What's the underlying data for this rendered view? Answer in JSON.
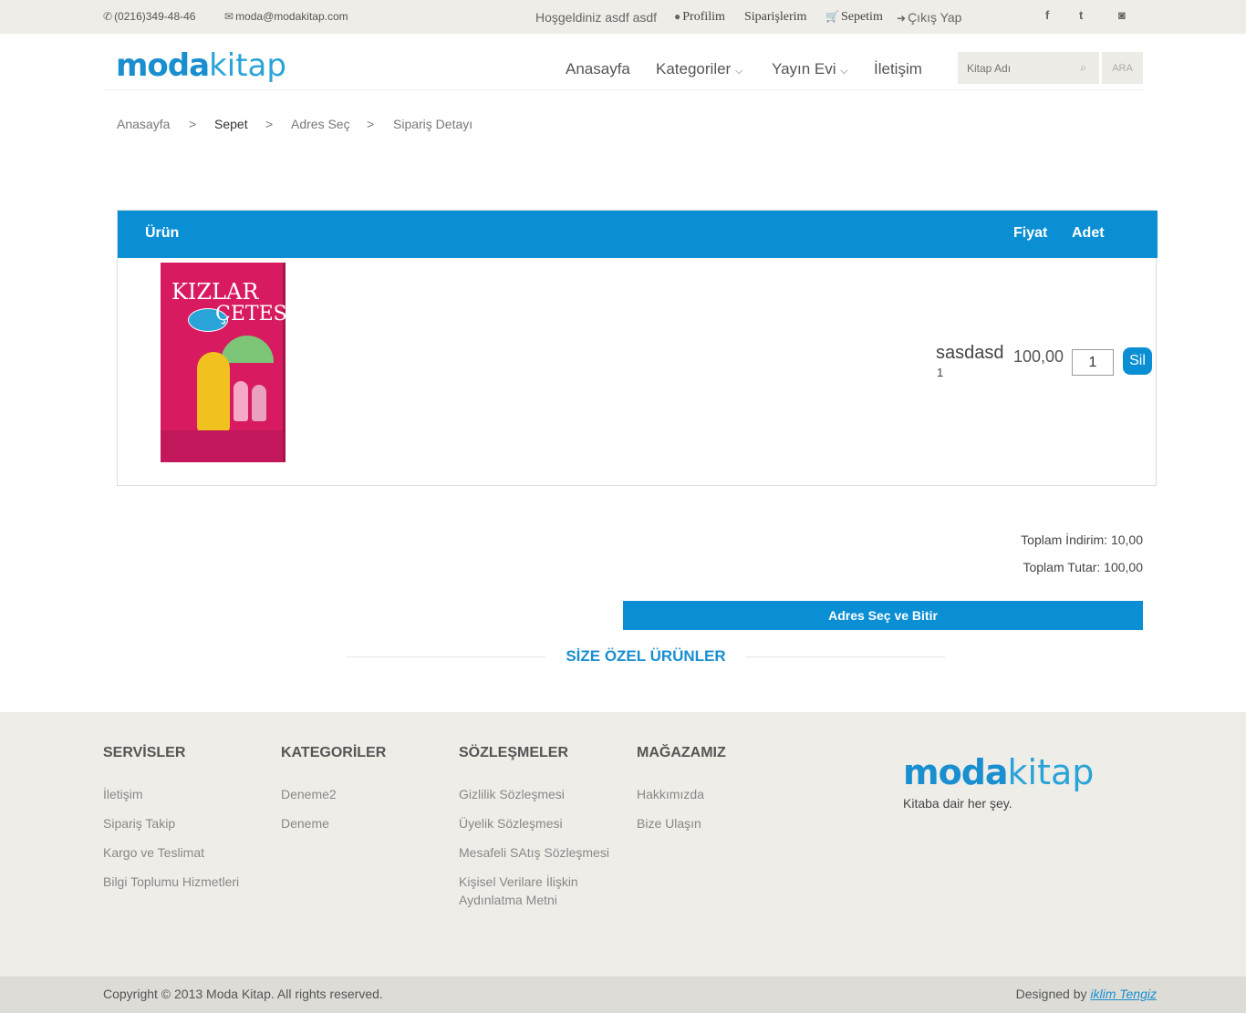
{
  "topbar": {
    "phone": "(0216)349-48-46",
    "email": "moda@modakitap.com",
    "welcome": "Hoşgeldiniz asdf asdf",
    "profile": "Profilim",
    "orders": "Siparişlerim",
    "cart": "Sepetim",
    "logout": "Çıkış Yap"
  },
  "logo": {
    "part1": "moda",
    "part2": "kitap"
  },
  "nav": {
    "home": "Anasayfa",
    "categories": "Kategoriler",
    "publisher": "Yayın Evi",
    "contact": "İletişim"
  },
  "search": {
    "placeholder": "Kitap Adı",
    "button": "ARA"
  },
  "breadcrumb": [
    "Anasayfa",
    ">",
    "Sepet",
    ">",
    "Adres Seç",
    ">",
    "Sipariş Detayı"
  ],
  "cart": {
    "headers": {
      "product": "Ürün",
      "price": "Fiyat",
      "qty": "Adet"
    },
    "item": {
      "book_title_1": "KIZLAR",
      "book_title_2": "ÇETESİ",
      "name": "sasdasd",
      "sub": "1",
      "price": "100,00",
      "qty": "1",
      "delete": "Sil"
    }
  },
  "totals": {
    "discount": "Toplam İndirim: 10,00",
    "total": "Toplam Tutar: 100,00"
  },
  "finish_button": "Adres Seç ve Bitir",
  "special_title": "SİZE ÖZEL ÜRÜNLER",
  "footer": {
    "services": {
      "title": "SERVİSLER",
      "links": [
        "İletişim",
        "Sipariş Takip",
        "Kargo ve Teslimat",
        "Bilgi Toplumu Hizmetleri"
      ]
    },
    "categories": {
      "title": "KATEGORİLER",
      "links": [
        "Deneme2",
        "Deneme"
      ]
    },
    "contracts": {
      "title": "SÖZLEŞMELER",
      "links": [
        "Gizlilik Sözleşmesi",
        "Üyelik Sözleşmesi",
        "Mesafeli SAtış Sözleşmesi",
        "Kişisel Verilare İlişkin Aydınlatma Metni"
      ]
    },
    "store": {
      "title": "MAĞAZAMIZ",
      "links": [
        "Hakkımızda",
        "Bize Ulaşın"
      ]
    },
    "tagline": "Kitaba dair her şey.",
    "copyright": "Copyright © 2013 Moda Kitap. All rights reserved.",
    "designed_by": "Designed by",
    "designer": "iklim Tengiz"
  },
  "colors": {
    "accent": "#0b8fd4",
    "bar": "#efede8"
  }
}
